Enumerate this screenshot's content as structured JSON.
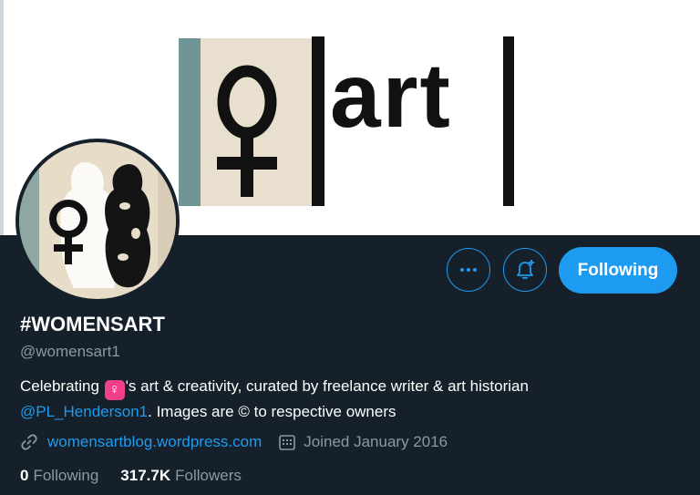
{
  "banner": {
    "text": "art",
    "symbol": "♀",
    "colors": {
      "background": "#ffffff",
      "paper": "#e9dfcf",
      "teal": "#6f9596",
      "ink": "#111111"
    }
  },
  "profile": {
    "display_name": "#WOMENSART",
    "handle": "@womensart1",
    "bio": {
      "part1": "Celebrating ",
      "emoji": "♀",
      "part2": "'s art & creativity, curated by freelance writer & art historian",
      "mention": "@PL_Henderson1",
      "part3": ". Images are © to respective owners"
    },
    "website": "womensartblog.wordpress.com",
    "joined": "Joined January 2016",
    "following_count": "0",
    "following_label": "Following",
    "followers_count": "317.7K",
    "followers_label": "Followers"
  },
  "actions": {
    "more_icon": "more-horizontal-icon",
    "notify_icon": "bell-plus-icon",
    "following_button": "Following"
  },
  "colors": {
    "page_background": "#15202b",
    "accent": "#1d9bf0",
    "secondary_text": "#8b98a5",
    "emoji_badge": "#f0408c"
  }
}
